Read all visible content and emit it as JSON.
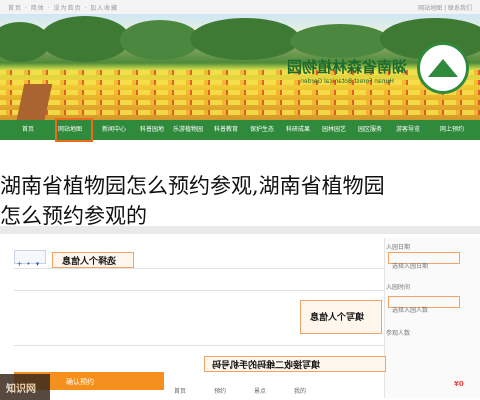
{
  "topbar": {
    "left_text": "首页 · 简体 · 设为首页 · 加入收藏",
    "right_text": "网站地图 | 联系我们"
  },
  "banner": {
    "title": "湖南省森林植物园",
    "subtitle": "Hunan Forest Botanical Garden"
  },
  "nav": {
    "items": [
      "首页",
      "网站地图",
      "新闻中心",
      "科普园地",
      "乐游植物园",
      "科普教育",
      "保护生态",
      "科研成果",
      "园林园艺",
      "园区服务",
      "游客导览",
      "网上预约"
    ],
    "highlighted_index": 1,
    "highlight_color": "#ef6a1c"
  },
  "headline": {
    "line1": "湖南省植物园怎么预约参观,湖南省植物园",
    "line2": "怎么预约参观的"
  },
  "form": {
    "step1_note": "填写个人信息",
    "step2_note": "选择个人信息",
    "step3_note": "填写接收二维码的手机号码",
    "side_labels": [
      "入园日期",
      "入园时间",
      "参观人数"
    ],
    "side_actions": [
      "选择入园日期",
      "选择入园人数"
    ],
    "submit_label": "确认预约",
    "watermark": "知识网",
    "bottom_links": [
      "首页",
      "预约",
      "景点",
      "我的"
    ],
    "price_tag": "¥0"
  },
  "colors": {
    "nav_bg": "#2f8a3c",
    "accent": "#ef6a1c",
    "submit_bg": "#f5901f"
  }
}
